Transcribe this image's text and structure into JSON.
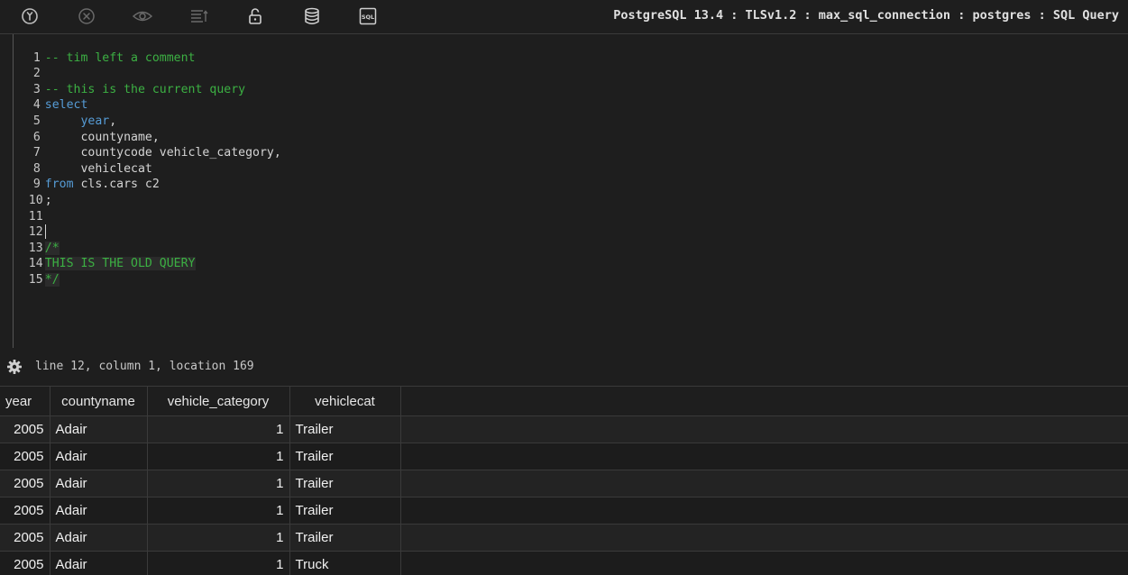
{
  "toolbar": {
    "icons": [
      {
        "name": "execute-icon"
      },
      {
        "name": "cancel-icon"
      },
      {
        "name": "eye-icon"
      },
      {
        "name": "format-icon"
      },
      {
        "name": "unlock-icon"
      },
      {
        "name": "database-icon"
      },
      {
        "name": "sql-icon",
        "label": "SQL"
      }
    ],
    "connection_info": "PostgreSQL 13.4 : TLSv1.2 : max_sql_connection : postgres : SQL Query"
  },
  "editor": {
    "lines": [
      {
        "num": "1",
        "text": "-- tim left a comment"
      },
      {
        "num": "2",
        "text": ""
      },
      {
        "num": "3",
        "text": "-- this is the current query"
      },
      {
        "num": "4",
        "kw": "select",
        "rest": ""
      },
      {
        "num": "5",
        "indent": "     ",
        "kw": "year",
        "rest": ","
      },
      {
        "num": "6",
        "text": "     countyname,"
      },
      {
        "num": "7",
        "text": "     countycode vehicle_category,"
      },
      {
        "num": "8",
        "text": "     vehiclecat"
      },
      {
        "num": "9",
        "kw": "from",
        "rest": " cls.cars c2"
      },
      {
        "num": "10",
        "text": ";"
      },
      {
        "num": "11",
        "text": ""
      },
      {
        "num": "12",
        "text": ""
      },
      {
        "num": "13",
        "text": "/*"
      },
      {
        "num": "14",
        "text": "THIS IS THE OLD QUERY"
      },
      {
        "num": "15",
        "text": "*/"
      }
    ],
    "colors": {
      "comment": "#3cb043",
      "keyword": "#569cd6"
    }
  },
  "status": {
    "position_text": "line 12, column 1, location 169"
  },
  "results": {
    "columns": [
      "year",
      "countyname",
      "vehicle_category",
      "vehiclecat"
    ],
    "rows": [
      [
        "2005",
        "Adair",
        "1",
        "Trailer"
      ],
      [
        "2005",
        "Adair",
        "1",
        "Trailer"
      ],
      [
        "2005",
        "Adair",
        "1",
        "Trailer"
      ],
      [
        "2005",
        "Adair",
        "1",
        "Trailer"
      ],
      [
        "2005",
        "Adair",
        "1",
        "Trailer"
      ],
      [
        "2005",
        "Adair",
        "1",
        "Truck"
      ]
    ]
  }
}
